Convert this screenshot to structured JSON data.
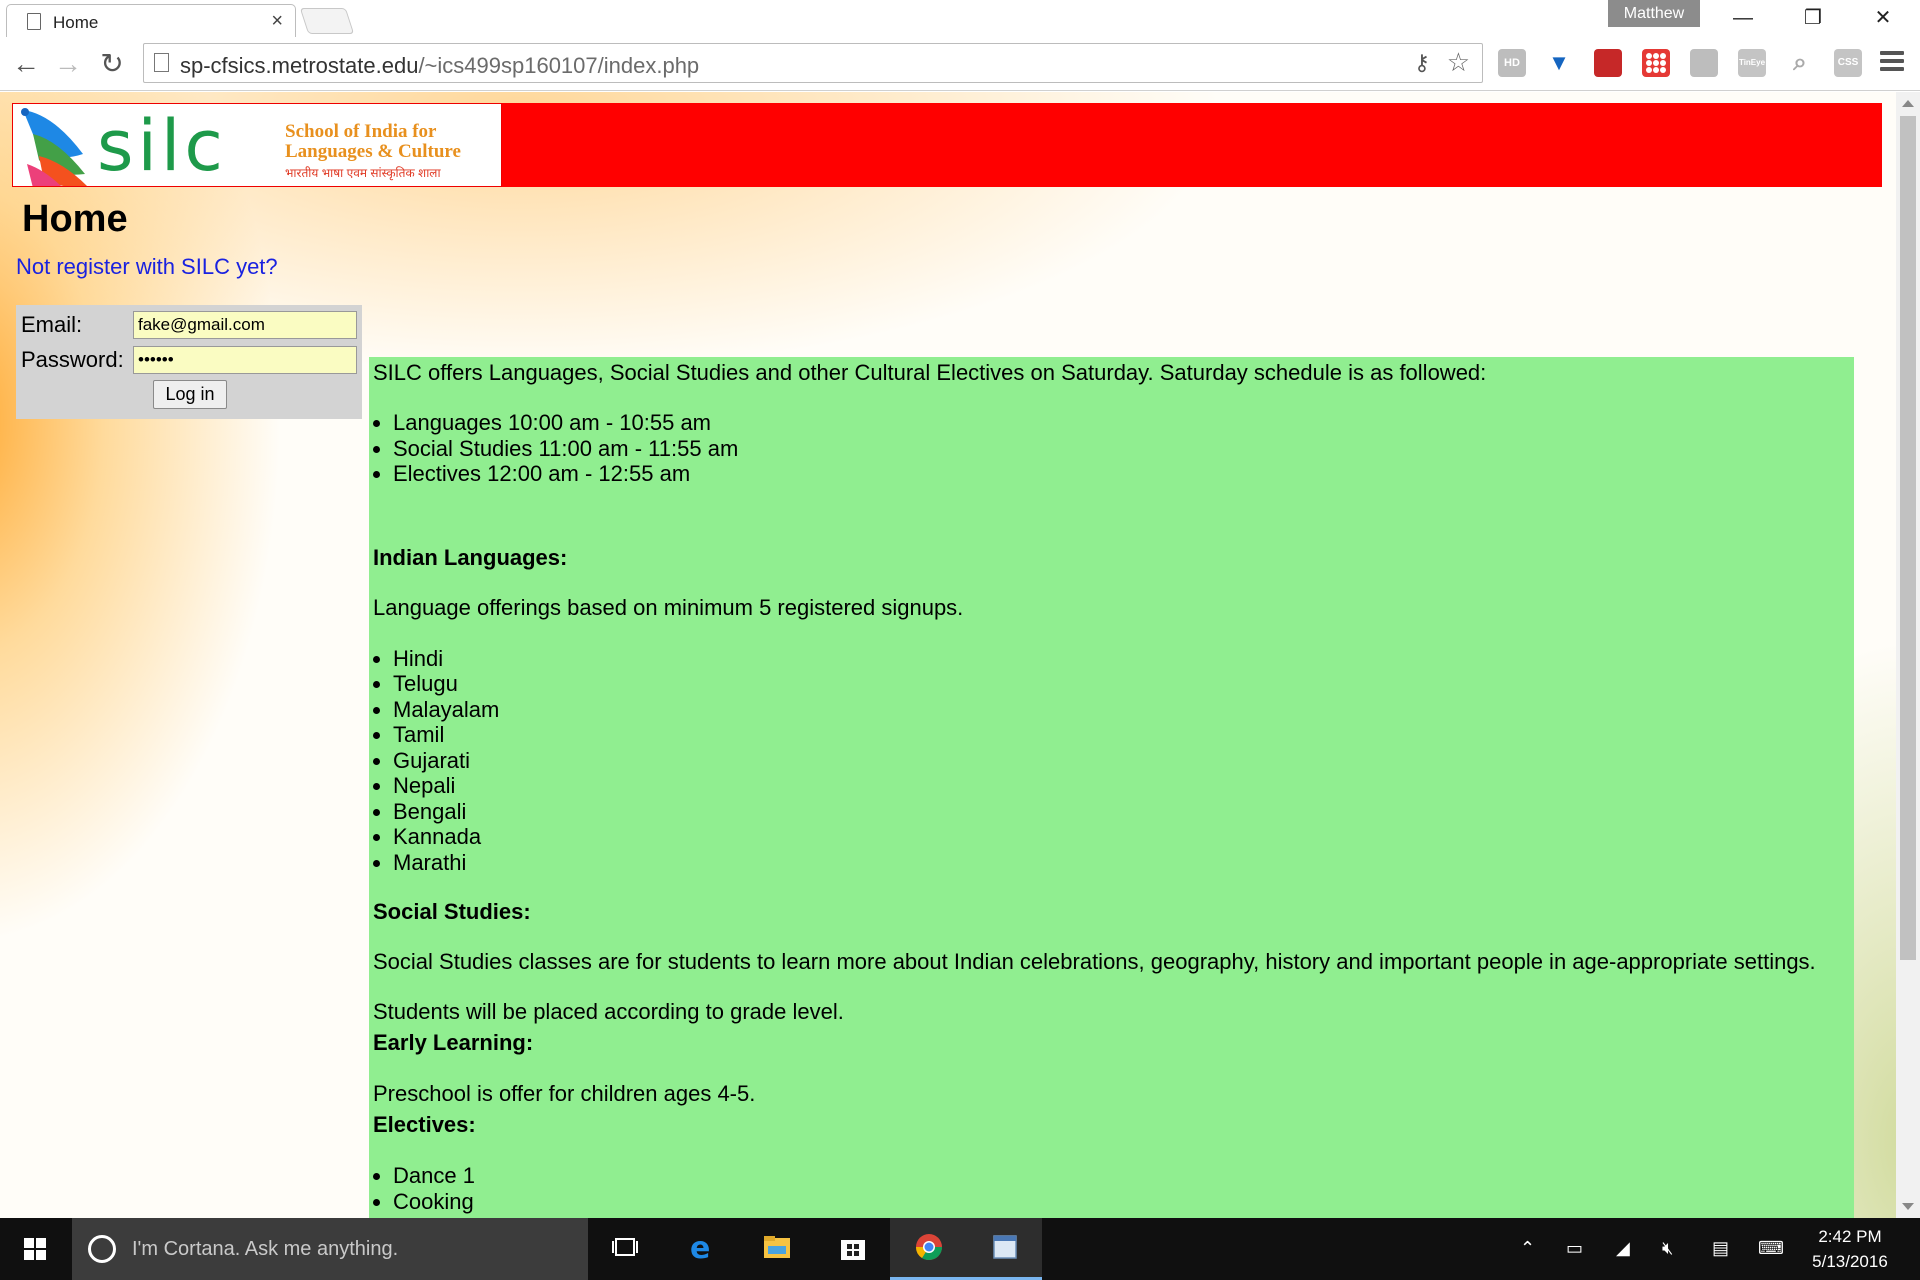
{
  "browser": {
    "tab_title": "Home",
    "tab_close": "×",
    "profile_name": "Matthew",
    "url_host": "sp-cfsics.metrostate.edu",
    "url_path": "/~ics499sp160107/index.php",
    "extensions": [
      "HD",
      "Y",
      "A",
      "grid",
      "chart",
      "TinEye",
      "search",
      "CSS"
    ]
  },
  "header": {
    "logo_wordmark": "silc",
    "logo_tagline_1": "School of India for",
    "logo_tagline_2": "Languages & Culture",
    "logo_hindi": "भारतीय भाषा एवम सांस्कृतिक शाला",
    "banner_color": "#ff0000"
  },
  "page": {
    "title": "Home",
    "register_link": "Not register with SILC yet?"
  },
  "login": {
    "email_label": "Email:",
    "email_value": "fake@gmail.com",
    "password_label": "Password:",
    "password_value": "••••••",
    "submit_label": "Log in"
  },
  "content": {
    "intro": "SILC offers Languages, Social Studies and other Cultural Electives on Saturday. Saturday schedule is as followed:",
    "schedule": [
      "Languages 10:00 am - 10:55 am",
      "Social Studies 11:00 am - 11:55 am",
      "Electives 12:00 am - 12:55 am"
    ],
    "languages_heading": "Indian Languages:",
    "languages_note": "Language offerings based on minimum 5 registered signups.",
    "languages": [
      "Hindi",
      "Telugu",
      "Malayalam",
      "Tamil",
      "Gujarati",
      "Nepali",
      "Bengali",
      "Kannada",
      "Marathi"
    ],
    "social_heading": "Social Studies:",
    "social_desc": "Social Studies classes are for students to learn more about Indian celebrations, geography, history and important people in age-appropriate settings.",
    "social_grade": "Students will be placed according to grade level.",
    "early_heading": "Early Learning:",
    "early_desc": "Preschool is offer for children ages 4-5.",
    "electives_heading": "Electives:",
    "electives": [
      "Dance 1",
      "Cooking"
    ],
    "background_color": "#90ee90"
  },
  "taskbar": {
    "cortana_placeholder": "I'm Cortana. Ask me anything.",
    "time": "2:42 PM",
    "date": "5/13/2016"
  }
}
